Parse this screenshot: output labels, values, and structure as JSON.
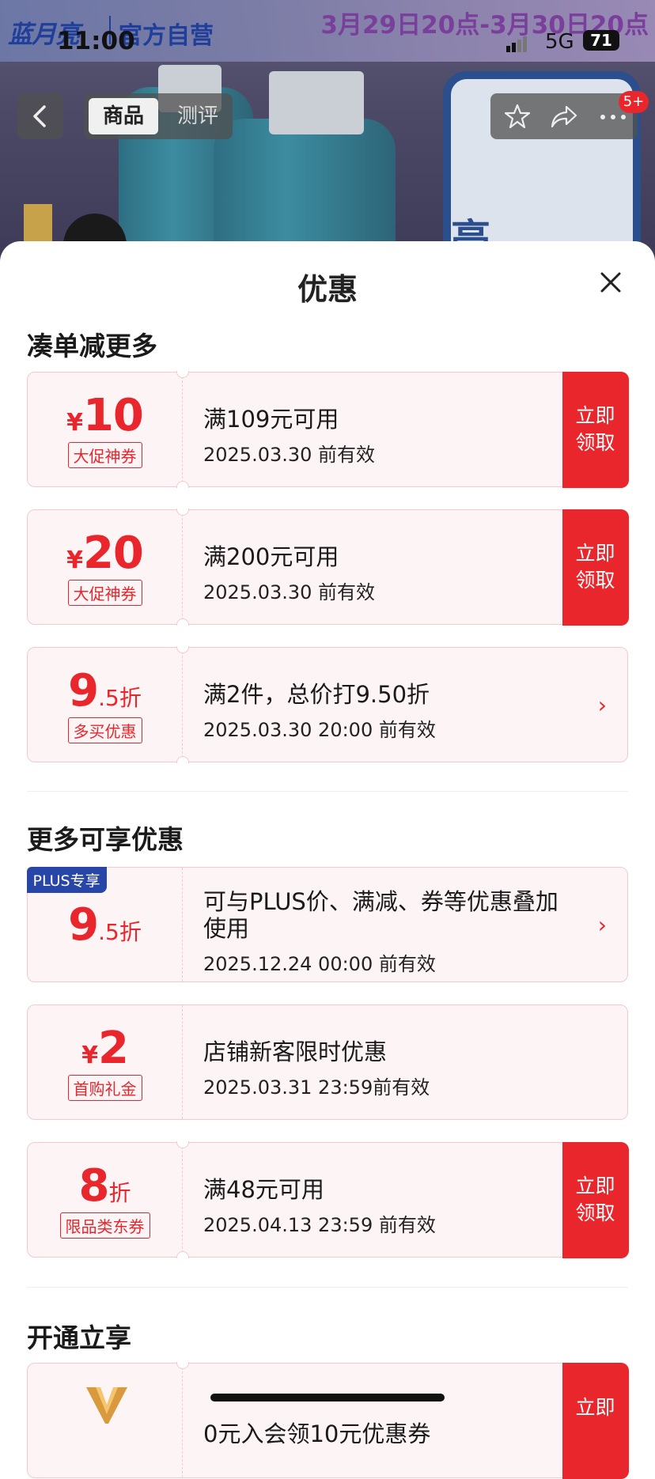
{
  "status_bar": {
    "time": "11:00",
    "network": "5G",
    "battery": "71"
  },
  "hero": {
    "brand_logo": "蓝月亮",
    "brand_official": "官方自营",
    "promo_time": "3月29日20点-3月30日20点",
    "bag_text": "亮"
  },
  "nav": {
    "tab_product": "商品",
    "tab_review": "测评",
    "badge": "5+"
  },
  "sheet": {
    "title": "优惠",
    "section1_title": "凑单减更多",
    "section2_title": "更多可享优惠",
    "section3_title": "开通立享",
    "claim_label_line1": "立即",
    "claim_label_line2": "领取",
    "coupons": [
      {
        "currency": "¥",
        "amount": "10",
        "suffix": "",
        "tag": "大促神券",
        "condition": "满109元可用",
        "valid": "2025.03.30 前有效",
        "action": "claim"
      },
      {
        "currency": "¥",
        "amount": "20",
        "suffix": "",
        "tag": "大促神券",
        "condition": "满200元可用",
        "valid": "2025.03.30 前有效",
        "action": "claim"
      },
      {
        "currency": "",
        "amount": "9",
        "suffix": ".5折",
        "tag": "多买优惠",
        "condition": "满2件，总价打9.50折",
        "valid": "2025.03.30 20:00 前有效",
        "action": "arrow"
      },
      {
        "currency": "",
        "amount": "9",
        "suffix": ".5折",
        "tag": "",
        "plus_tag": "PLUS专享",
        "condition_line1": "可与PLUS价、满减、券等优惠叠加",
        "condition_line2": "使用",
        "valid": "2025.12.24 00:00 前有效",
        "action": "arrow"
      },
      {
        "currency": "¥",
        "amount": "2",
        "suffix": "",
        "tag": "首购礼金",
        "condition": "店铺新客限时优惠",
        "valid": "2025.03.31 23:59前有效",
        "action": "none"
      },
      {
        "currency": "",
        "amount": "8",
        "suffix": "折",
        "tag": "限品类东券",
        "condition": "满48元可用",
        "valid": "2025.04.13 23:59 前有效",
        "action": "claim"
      },
      {
        "condition": "0元入会领10元优惠券",
        "claim_partial": "立即"
      }
    ]
  },
  "colors": {
    "accent_red": "#e8262c",
    "plus_blue": "#2746a8",
    "coupon_bg": "#fdf4f5"
  }
}
